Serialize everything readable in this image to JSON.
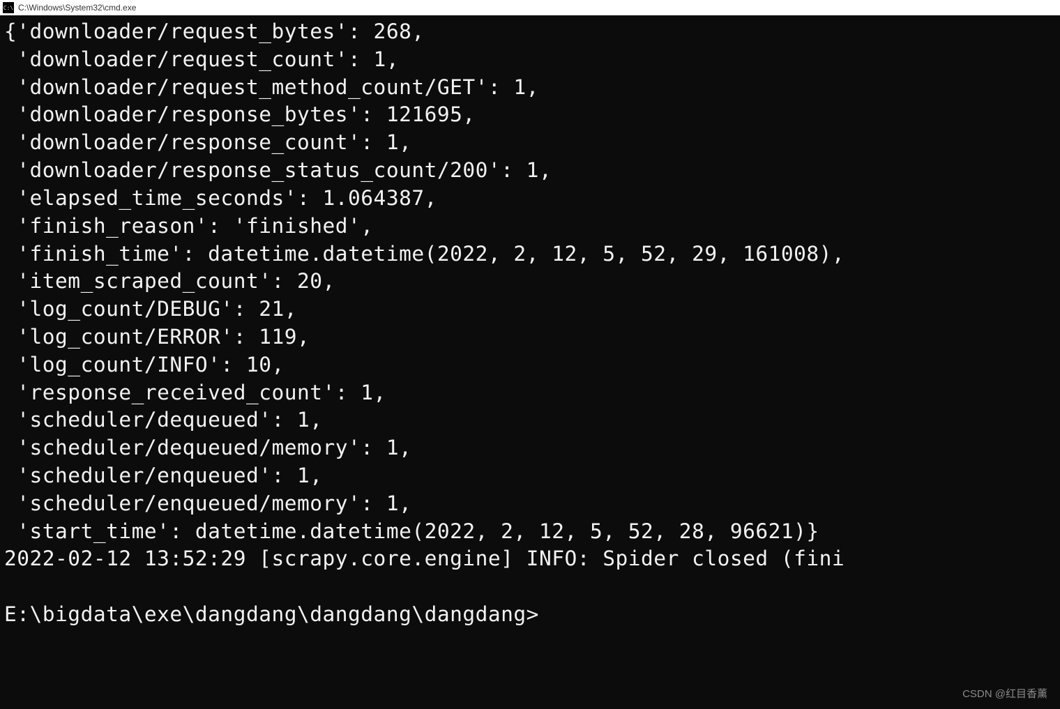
{
  "window": {
    "title": "C:\\Windows\\System32\\cmd.exe",
    "icon_label": "C:\\"
  },
  "output": {
    "brace_open": "{",
    "brace_close": "}",
    "stats": [
      {
        "key": "downloader/request_bytes",
        "value": "268"
      },
      {
        "key": "downloader/request_count",
        "value": "1"
      },
      {
        "key": "downloader/request_method_count/GET",
        "value": "1"
      },
      {
        "key": "downloader/response_bytes",
        "value": "121695"
      },
      {
        "key": "downloader/response_count",
        "value": "1"
      },
      {
        "key": "downloader/response_status_count/200",
        "value": "1"
      },
      {
        "key": "elapsed_time_seconds",
        "value": "1.064387"
      },
      {
        "key": "finish_reason",
        "value": "'finished'"
      },
      {
        "key": "finish_time",
        "value": "datetime.datetime(2022, 2, 12, 5, 52, 29, 161008)"
      },
      {
        "key": "item_scraped_count",
        "value": "20"
      },
      {
        "key": "log_count/DEBUG",
        "value": "21"
      },
      {
        "key": "log_count/ERROR",
        "value": "119"
      },
      {
        "key": "log_count/INFO",
        "value": "10"
      },
      {
        "key": "response_received_count",
        "value": "1"
      },
      {
        "key": "scheduler/dequeued",
        "value": "1"
      },
      {
        "key": "scheduler/dequeued/memory",
        "value": "1"
      },
      {
        "key": "scheduler/enqueued",
        "value": "1"
      },
      {
        "key": "scheduler/enqueued/memory",
        "value": "1"
      },
      {
        "key": "start_time",
        "value": "datetime.datetime(2022, 2, 12, 5, 52, 28, 96621)"
      }
    ],
    "log_line": "2022-02-12 13:52:29 [scrapy.core.engine] INFO: Spider closed (fini",
    "blank_line": "",
    "prompt": "E:\\bigdata\\exe\\dangdang\\dangdang\\dangdang>"
  },
  "watermark": "CSDN @红目香薰"
}
